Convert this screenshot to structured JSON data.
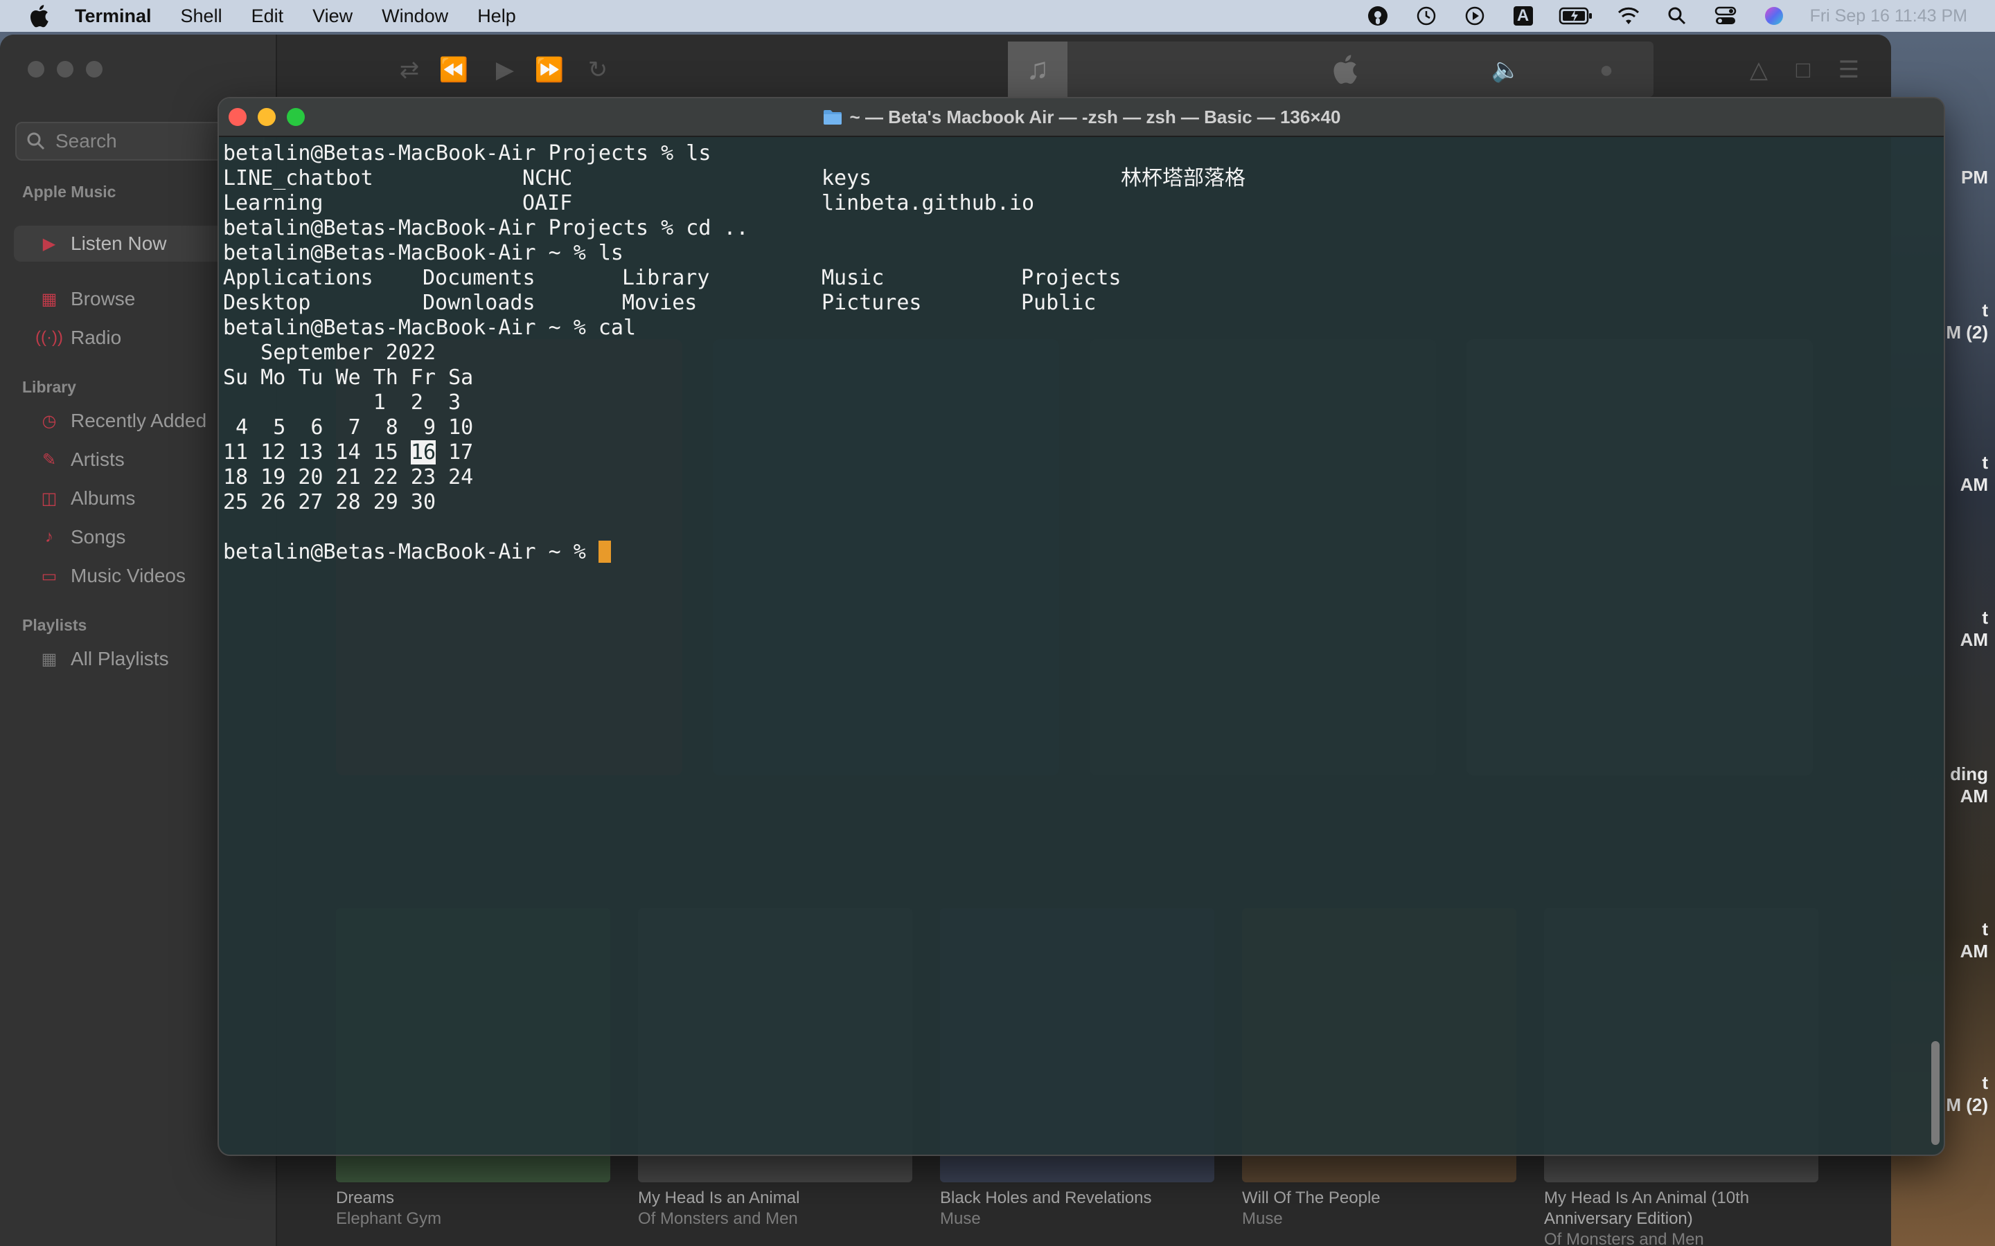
{
  "menubar": {
    "app": "Terminal",
    "items": [
      "Shell",
      "Edit",
      "View",
      "Window",
      "Help"
    ],
    "clock": "Fri Sep 16  11:43 PM",
    "status_icons": [
      "podcast-icon",
      "time-machine-icon",
      "play-icon",
      "input-source-icon",
      "battery-icon",
      "wifi-icon",
      "spotlight-icon",
      "control-center-icon",
      "siri-icon"
    ],
    "input_source_label": "A"
  },
  "music": {
    "search_placeholder": "Search",
    "sections": {
      "apple_music": "Apple Music",
      "library": "Library",
      "playlists": "Playlists"
    },
    "apple_music_items": [
      "Listen Now",
      "Browse",
      "Radio"
    ],
    "library_items": [
      "Recently Added",
      "Artists",
      "Albums",
      "Songs",
      "Music Videos"
    ],
    "playlist_items": [
      "All Playlists"
    ],
    "recent_captions": [
      {
        "title": "Dreams",
        "subtitle": "Elephant Gym"
      },
      {
        "title": "My Head Is an Animal",
        "subtitle": "Of Monsters and Men"
      },
      {
        "title": "Black Holes and Revelations",
        "subtitle": "Muse"
      },
      {
        "title": "Will Of The People",
        "subtitle": "Muse"
      },
      {
        "title": "My Head Is An Animal (10th Anniversary Edition)",
        "subtitle": "Of Monsters and Men"
      }
    ]
  },
  "notifications": [
    {
      "line1": "PM",
      "line2": ""
    },
    {
      "line1": "t",
      "line2": "M (2)"
    },
    {
      "line1": "t",
      "line2": "AM"
    },
    {
      "line1": "t",
      "line2": "AM"
    },
    {
      "line1": "ding",
      "line2": "AM"
    },
    {
      "line1": "t",
      "line2": "AM"
    },
    {
      "line1": "t",
      "line2": "M (2)"
    }
  ],
  "terminal": {
    "title": "~ — Beta's Macbook Air — -zsh — zsh — Basic — 136×40",
    "lines": {
      "l1": "betalin@Betas-MacBook-Air Projects % ls",
      "ls1": [
        [
          "LINE_chatbot",
          "NCHC",
          "keys",
          "林杯塔部落格"
        ],
        [
          "Learning",
          "OAIF",
          "linbeta.github.io",
          ""
        ]
      ],
      "l4": "betalin@Betas-MacBook-Air Projects % cd ..",
      "l5": "betalin@Betas-MacBook-Air ~ % ls",
      "ls2": [
        [
          "Applications",
          "Documents",
          "Library",
          "Music",
          "Projects"
        ],
        [
          "Desktop",
          "Downloads",
          "Movies",
          "Pictures",
          "Public"
        ]
      ],
      "l8": "betalin@Betas-MacBook-Air ~ % cal",
      "cal_title": "   September 2022",
      "cal_header": "Su Mo Tu We Th Fr Sa",
      "cal_w1": "            1  2  3",
      "cal_w2": " 4  5  6  7  8  9 10",
      "cal_w3_pre": "11 12 13 14 15 ",
      "cal_today": "16",
      "cal_w3_post": " 17",
      "cal_w4": "18 19 20 21 22 23 24",
      "cal_w5": "25 26 27 28 29 30",
      "prompt": "betalin@Betas-MacBook-Air ~ % "
    }
  }
}
